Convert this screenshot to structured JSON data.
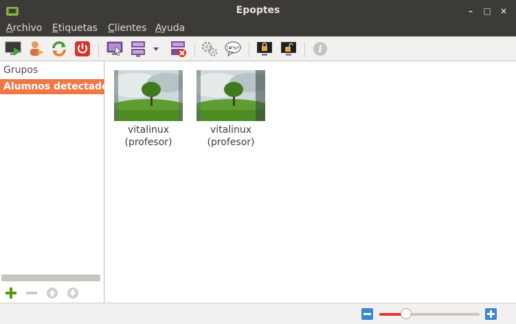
{
  "window": {
    "title": "Epoptes",
    "controls": {
      "minimize": "–",
      "maximize": "□",
      "close": "×"
    }
  },
  "menu": [
    {
      "label": "Archivo"
    },
    {
      "label": "Etiquetas"
    },
    {
      "label": "Clientes"
    },
    {
      "label": "Ayuda"
    }
  ],
  "toolbar": {
    "icons": [
      "monitor-play-icon",
      "user-arrow-icon",
      "refresh-icon",
      "power-icon",
      "remote-assist-icon",
      "broadcast-screen-icon",
      "dropdown-icon",
      "stop-broadcast-icon",
      "settings-gears-icon",
      "chat-icon",
      "lock-screen-icon",
      "unlock-screen-icon",
      "info-icon"
    ]
  },
  "sidebar": {
    "header": "Grupos",
    "groups": [
      {
        "label": "Alumnos detectados",
        "selected": true
      }
    ],
    "actions": [
      "add-icon",
      "remove-icon",
      "move-up-icon",
      "move-down-icon"
    ]
  },
  "clients": [
    {
      "name": "vitalinux",
      "role": "(profesor)"
    },
    {
      "name": "vitalinux",
      "role": "(profesor)"
    }
  ],
  "zoom": {
    "level": 0.27
  },
  "colors": {
    "accent": "#f07746",
    "slider": "#e9353a",
    "zoom_button": "#3d86d0",
    "titlebar": "#3c3b37"
  }
}
